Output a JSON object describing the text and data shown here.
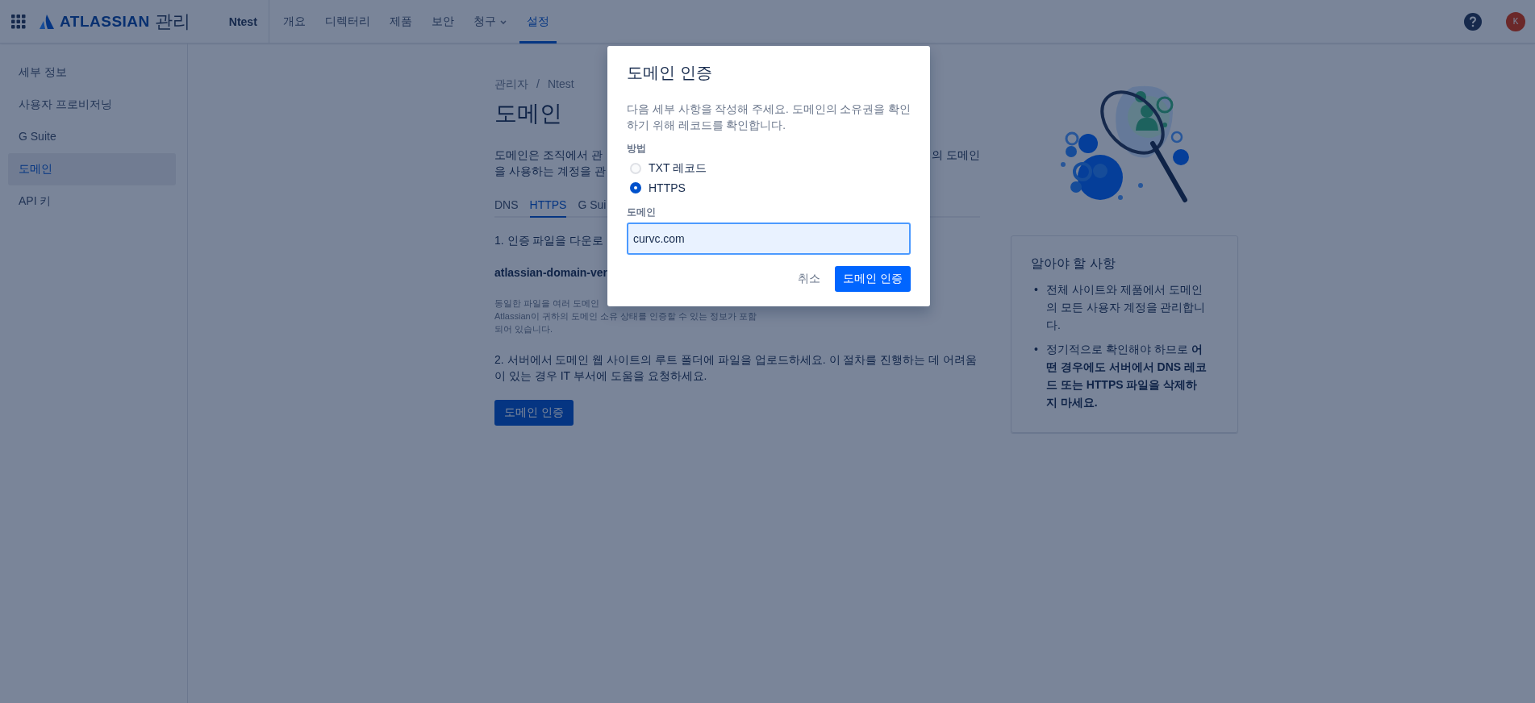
{
  "top_nav": {
    "product": "ATLASSIAN",
    "product_suffix": "관리",
    "org": "Ntest",
    "items": [
      {
        "label": "개요",
        "selected": false,
        "dropdown": false
      },
      {
        "label": "디렉터리",
        "selected": false,
        "dropdown": false
      },
      {
        "label": "제품",
        "selected": false,
        "dropdown": false
      },
      {
        "label": "보안",
        "selected": false,
        "dropdown": false
      },
      {
        "label": "청구",
        "selected": false,
        "dropdown": true
      },
      {
        "label": "설정",
        "selected": true,
        "dropdown": false
      }
    ],
    "avatar": "K"
  },
  "sidebar": {
    "items": [
      {
        "label": "세부 정보",
        "selected": false
      },
      {
        "label": "사용자 프로비저닝",
        "selected": false
      },
      {
        "label": "G Suite",
        "selected": false
      },
      {
        "label": "도메인",
        "selected": true
      },
      {
        "label": "API 키",
        "selected": false
      }
    ]
  },
  "main": {
    "breadcrumbs": [
      "관리자",
      "Ntest"
    ],
    "breadcrumb_separator": "/",
    "title": "도메인",
    "intro_lines": [
      {
        "left": "도메인은 조직에서 관",
        "right": "의 도메인"
      },
      {
        "left": "을 사용하는 계정을 관"
      }
    ],
    "tabs": [
      {
        "label": "DNS",
        "selected": false
      },
      {
        "label": "HTTPS",
        "selected": true
      },
      {
        "label": "G Sui",
        "selected": false
      }
    ],
    "step_1": "1. 인증 파일을 다운로",
    "file_name": "atlassian-domain-ver",
    "note_lines": [
      "동일한 파일을 여러 도메인",
      "Atlassian이 귀하의 도메인 소유 상태를 인증할 수 있는 정보가 포함",
      "되어 있습니다."
    ],
    "step_2": "2. 서버에서 도메인 웹 사이트의 루트 폴더에 파일을 업로드하세요. 이 절차를 진행하는 데 어려움이 있는 경우 IT 부서에 도움을 요청하세요.",
    "verify_button": "도메인 인증"
  },
  "info_card": {
    "title": "알아야 할 사항",
    "bullet_marker": "•",
    "bullets": [
      "전체 사이트와 제품에서 도메인의 모든 사용자 계정을 관리합니다.",
      "정기적으로 확인해야 하므로 **어떤 경우에도 서버에서 DNS 레코드 또는 HTTPS 파일을 삭제하지 마세요.**"
    ]
  },
  "dialog": {
    "title": "도메인 인증",
    "description": "다음 세부 사항을 작성해 주세요. 도메인의 소유권을 확인하기 위해 레코드를 확인합니다.",
    "method_label": "방법",
    "methods": [
      {
        "label": "TXT 레코드",
        "selected": false
      },
      {
        "label": "HTTPS",
        "selected": true
      }
    ],
    "domain_label": "도메인",
    "domain_value": "curvc.com",
    "domain_focused": true,
    "buttons": [
      {
        "label": "취소",
        "kind": "subtle"
      },
      {
        "label": "도메인 인증",
        "kind": "primary"
      }
    ]
  }
}
